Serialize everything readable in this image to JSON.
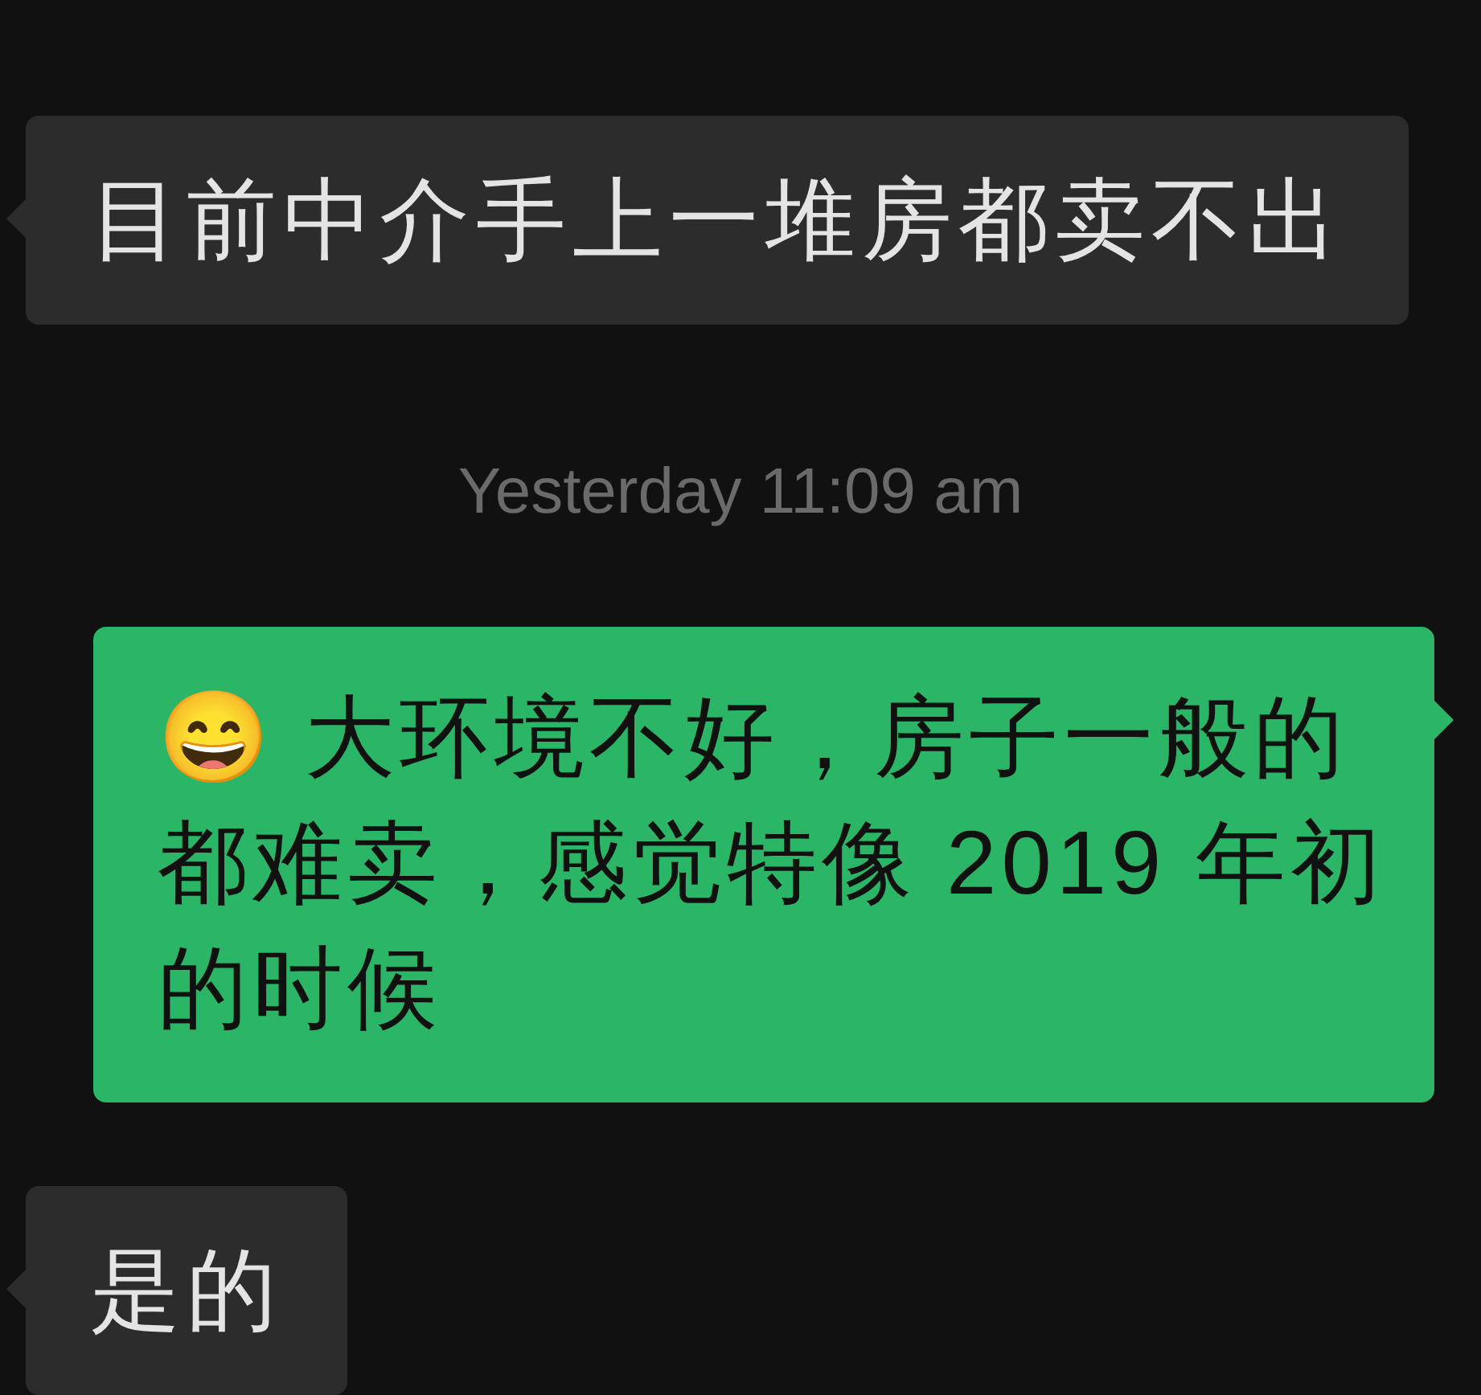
{
  "messages": [
    {
      "kind": "incoming",
      "text": "目前中介手上一堆房都卖不出"
    },
    {
      "kind": "timestamp",
      "text": "Yesterday 11:09 am"
    },
    {
      "kind": "outgoing",
      "text": "😄 大环境不好，房子一般的都难卖，感觉特像 2019 年初的时候"
    },
    {
      "kind": "incoming",
      "text": "是的"
    }
  ]
}
